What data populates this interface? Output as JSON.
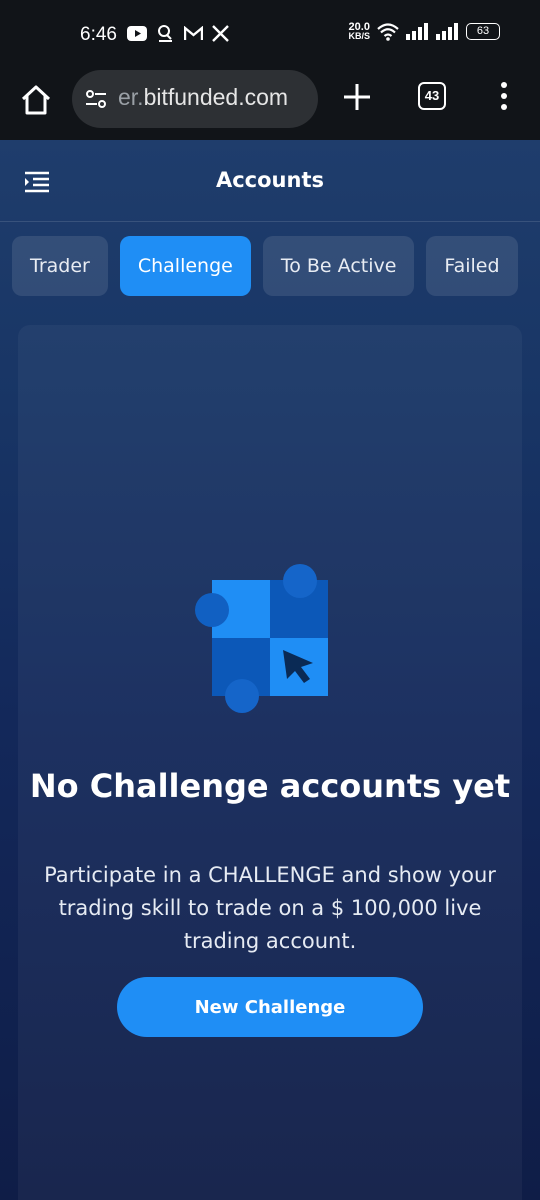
{
  "status_bar": {
    "time": "6:46",
    "net_speed_value": "20.0",
    "net_speed_unit": "KB/S",
    "battery": "63",
    "icons_left": [
      "youtube-icon",
      "app-icon",
      "gmail-icon",
      "x-icon"
    ],
    "icons_right": [
      "wifi-icon",
      "signal-icon",
      "signal-icon"
    ]
  },
  "browser": {
    "url_prefix": "er.",
    "url_domain": "bitfunded.com",
    "tab_count": "43"
  },
  "app": {
    "title": "Accounts",
    "tabs": [
      {
        "label": "Trader",
        "active": false
      },
      {
        "label": "Challenge",
        "active": true
      },
      {
        "label": "To Be Active",
        "active": false
      },
      {
        "label": "Failed",
        "active": false
      }
    ],
    "empty_state": {
      "title": "No Challenge accounts yet",
      "description": "Participate in a CHALLENGE and show your trading skill to trade on a $ 100,000 live trading account.",
      "button_label": "New Challenge"
    }
  },
  "colors": {
    "accent": "#1f8ef5",
    "page_bg": "#13285a",
    "browser_bg": "#111418"
  }
}
